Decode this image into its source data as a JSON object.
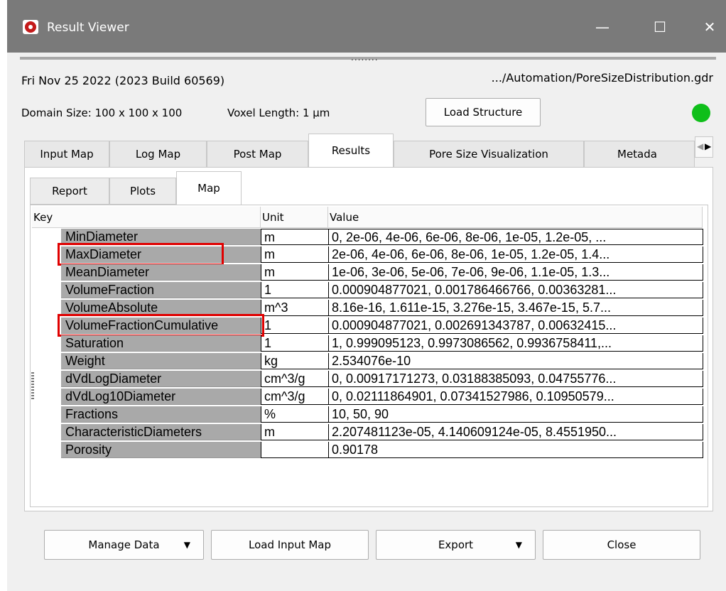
{
  "window": {
    "title": "Result Viewer",
    "controls": {
      "minimize": "—",
      "maximize": "☐",
      "close": "✕"
    }
  },
  "splitter": {
    "dots": "........"
  },
  "header": {
    "build_info": "Fri Nov 25 2022 (2023 Build 60569)",
    "file_path": ".../Automation/PoreSizeDistribution.gdr",
    "domain_size": "Domain Size: 100 x 100 x 100",
    "voxel_length": "Voxel Length: 1 µm",
    "load_structure_label": "Load Structure",
    "status_color": "#0fbf1a"
  },
  "main_tabs": [
    {
      "label": "Input Map"
    },
    {
      "label": "Log Map"
    },
    {
      "label": "Post Map"
    },
    {
      "label": "Results",
      "active": true
    },
    {
      "label": "Pore Size Visualization"
    },
    {
      "label": "Metada"
    }
  ],
  "sub_tabs": [
    {
      "label": "Report"
    },
    {
      "label": "Plots"
    },
    {
      "label": "Map",
      "active": true
    }
  ],
  "table": {
    "columns": [
      "Key",
      "Unit",
      "Value"
    ],
    "rows": [
      {
        "key": "MinDiameter",
        "unit": "m",
        "value": "0, 2e-06, 4e-06, 6e-06, 8e-06, 1e-05, 1.2e-05, ..."
      },
      {
        "key": "MaxDiameter",
        "unit": "m",
        "value": "2e-06, 4e-06, 6e-06, 8e-06, 1e-05, 1.2e-05, 1.4...",
        "highlighted": true
      },
      {
        "key": "MeanDiameter",
        "unit": "m",
        "value": "1e-06, 3e-06, 5e-06, 7e-06, 9e-06, 1.1e-05, 1.3..."
      },
      {
        "key": "VolumeFraction",
        "unit": "1",
        "value": "0.000904877021, 0.001786466766, 0.00363281..."
      },
      {
        "key": "VolumeAbsolute",
        "unit": "m^3",
        "value": "8.16e-16, 1.611e-15, 3.276e-15, 3.467e-15, 5.7..."
      },
      {
        "key": "VolumeFractionCumulative",
        "unit": "1",
        "value": "0.000904877021, 0.002691343787, 0.00632415...",
        "highlighted": true
      },
      {
        "key": "Saturation",
        "unit": "1",
        "value": "1, 0.999095123, 0.9973086562, 0.9936758411,..."
      },
      {
        "key": "Weight",
        "unit": "kg",
        "value": "2.534076e-10"
      },
      {
        "key": "dVdLogDiameter",
        "unit": "cm^3/g",
        "value": "0, 0.00917171273, 0.03188385093, 0.04755776..."
      },
      {
        "key": "dVdLog10Diameter",
        "unit": "cm^3/g",
        "value": "0, 0.02111864901, 0.07341527986, 0.10950579..."
      },
      {
        "key": "Fractions",
        "unit": "%",
        "value": "10, 50, 90"
      },
      {
        "key": "CharacteristicDiameters",
        "unit": "m",
        "value": "2.207481123e-05, 4.140609124e-05, 8.4551950..."
      },
      {
        "key": "Porosity",
        "unit": "",
        "value": "0.90178"
      }
    ]
  },
  "bottom_buttons": {
    "manage_data": "Manage Data",
    "load_input_map": "Load Input Map",
    "export": "Export",
    "close": "Close"
  },
  "icons": {
    "app": "app-logo-icon",
    "dropdown": "▼",
    "tab_left": "◀",
    "tab_right": "▶"
  },
  "colors": {
    "titlebar": "#7a7a7a",
    "highlight": "#e00000",
    "key_column": "#a9a9a9"
  }
}
